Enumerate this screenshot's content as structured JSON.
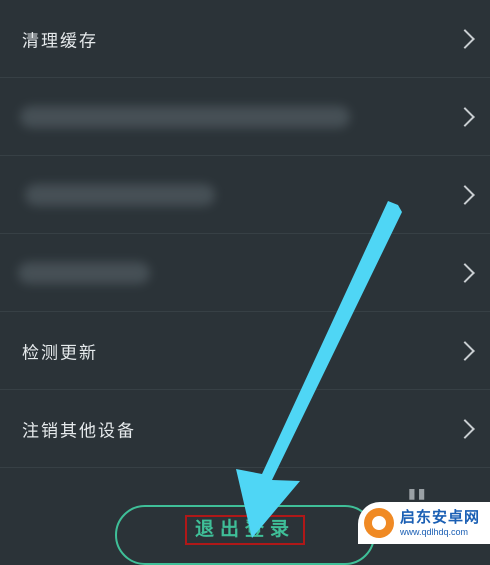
{
  "settings": {
    "items": [
      {
        "label": "清理缓存"
      },
      {
        "label": ""
      },
      {
        "label": ""
      },
      {
        "label": ""
      },
      {
        "label": "检测更新"
      },
      {
        "label": "注销其他设备"
      }
    ]
  },
  "logout": {
    "label": "退出登录"
  },
  "watermark": {
    "title": "启东安卓网",
    "url": "www.qdlhdq.com"
  },
  "colors": {
    "background": "#2b3338",
    "accent": "#3fbf98",
    "annotation_arrow": "#4fd6f5",
    "highlight_box": "#b01818"
  },
  "icons": {
    "row_chevron": "chevron-right-icon",
    "annotation": "arrow-annotation-icon"
  }
}
